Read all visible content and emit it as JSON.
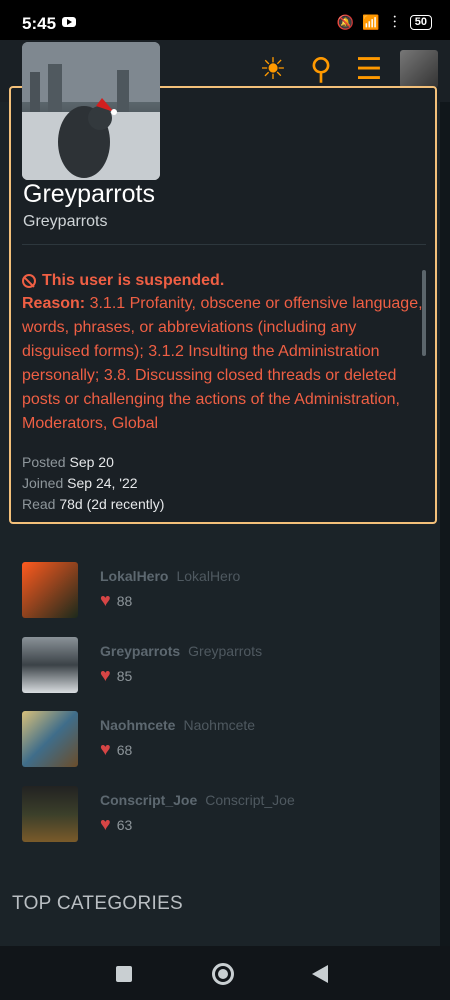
{
  "status": {
    "time": "5:45",
    "battery": "50"
  },
  "card": {
    "name": "Greyparrots",
    "subname": "Greyparrots",
    "suspended_title": "This user is suspended.",
    "reason_label": "Reason:",
    "reason_text": " 3.1.1 Profanity, obscene or offensive language, words, phrases, or abbreviations (including any disguised forms); 3.1.2 Insulting the Administration personally; 3.8. Discussing closed threads or deleted posts or challenging the actions of the Administration, Moderators, Global",
    "posted_label": "Posted",
    "posted_value": "Sep 20",
    "joined_label": "Joined",
    "joined_value": "Sep 24, '22",
    "read_label": "Read",
    "read_value": "78d (2d recently)"
  },
  "users": [
    {
      "username": "LokalHero",
      "display": "LokalHero",
      "likes": "88"
    },
    {
      "username": "Greyparrots",
      "display": "Greyparrots",
      "likes": "85"
    },
    {
      "username": "Naohmcete",
      "display": "Naohmcete",
      "likes": "68"
    },
    {
      "username": "Conscript_Joe",
      "display": "Conscript_Joe",
      "likes": "63"
    }
  ],
  "sections": {
    "top_categories": "TOP CATEGORIES"
  },
  "colors": {
    "accent": "#f3c07a",
    "danger": "#ef5f44",
    "heart": "#d64545",
    "header_icons": "#ff9900"
  },
  "icons": [
    "theme-sun-icon",
    "search-icon",
    "hamburger-menu-icon",
    "heart-icon",
    "ban-icon"
  ]
}
